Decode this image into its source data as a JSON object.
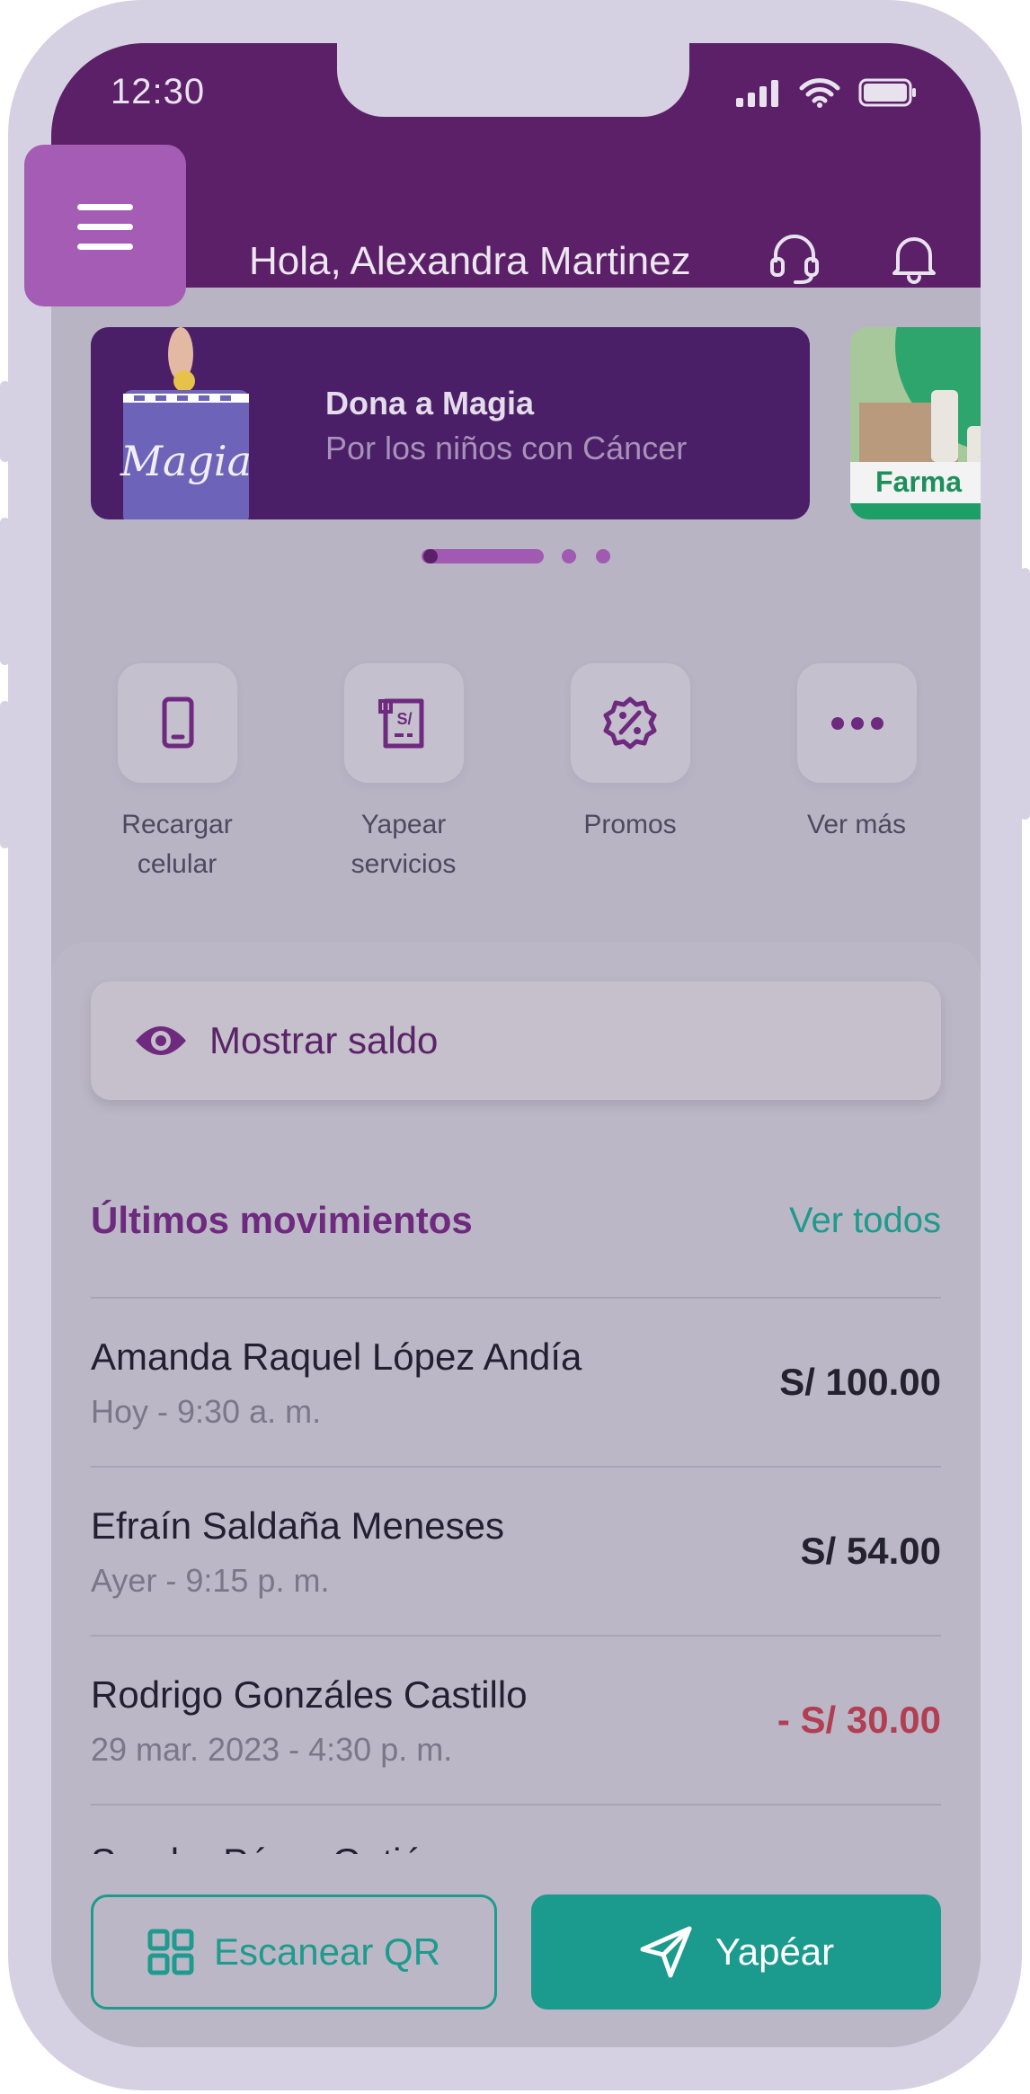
{
  "status_bar": {
    "time": "12:30"
  },
  "header": {
    "greeting": "Hola, Alexandra Martinez"
  },
  "banners": [
    {
      "title": "Dona a Magia",
      "subtitle": "Por los niños con Cáncer",
      "can_text": "Magia"
    },
    {
      "brand": "Farma"
    }
  ],
  "carousel": {
    "active_index": 0,
    "total": 3
  },
  "quick_actions": [
    {
      "label_line1": "Recargar",
      "label_line2": "celular",
      "icon": "phone-icon"
    },
    {
      "label_line1": "Yapear",
      "label_line2": "servicios",
      "icon": "receipt-icon",
      "icon_text": "S/"
    },
    {
      "label_line1": "Promos",
      "icon": "discount-badge-icon"
    },
    {
      "label_line1": "Ver más",
      "icon": "more-dots-icon"
    }
  ],
  "balance": {
    "label": "Mostrar saldo"
  },
  "movements": {
    "title": "Últimos movimientos",
    "link": "Ver todos",
    "items": [
      {
        "name": "Amanda Raquel López Andía",
        "date": "Hoy - 9:30 a. m.",
        "amount": "S/ 100.00"
      },
      {
        "name": "Efraín Saldaña Meneses",
        "date": "Ayer - 9:15 p. m.",
        "amount": "S/ 54.00"
      },
      {
        "name": "Rodrigo Gonzáles Castillo",
        "date": "29  mar.  2023 - 4:30 p. m.",
        "amount": "- S/ 30.00"
      },
      {
        "name": "Sandra Pérez Gutiérrez"
      }
    ]
  },
  "actions": {
    "scan": "Escanear QR",
    "send": "Yapéar"
  },
  "colors": {
    "header": "#5c2068",
    "accent_teal": "#1b9a8e",
    "negative": "#b13e52",
    "purple_text": "#6e2a7e"
  }
}
